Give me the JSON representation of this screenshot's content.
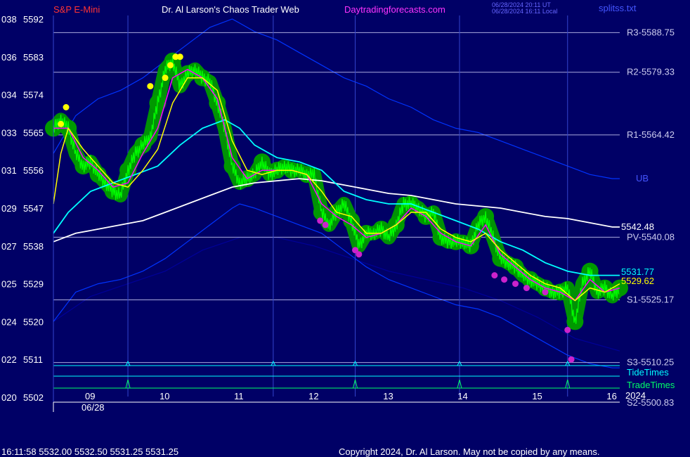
{
  "header": {
    "symbol": "S&P E-Mini",
    "author": "Dr. Al Larson's Chaos Trader Web",
    "site": "Daytradingforecasts.com",
    "stamp_1": "06/28/2024 20:11 UT",
    "stamp_2": "06/28/2024 16:11 Local",
    "file": "splitss.txt"
  },
  "footer": {
    "quote": "16:11:58  5532.00 5532.50 5531.25 5531.25",
    "copyright": "Copyright 2024, Dr. Al Larson. May not be copied by any means."
  },
  "colors": {
    "background": "#000066",
    "price": "#00ff00",
    "ema_fast": "#ff00ff",
    "ema_mid": "#ffff00",
    "ema_cyan": "#00ffff",
    "ema_white": "#ffffff",
    "band": "#0033ff",
    "flux_glow": "#009900",
    "level_line": "#aaaadd",
    "tide": "#00ffff",
    "trade": "#00ff66",
    "symbol_text": "#ff3333",
    "site_text": "#ff33ff"
  },
  "chart_data": {
    "type": "line",
    "title": "S&P E-Mini",
    "xlabel": "",
    "ylabel": "",
    "date_label": "06/28",
    "x_ticks": [
      "09",
      "10",
      "11",
      "12",
      "13",
      "14",
      "15",
      "16"
    ],
    "y_ticks": [
      {
        "left": "020",
        "price": "5502",
        "value": 5502
      },
      {
        "left": "022",
        "price": "5511",
        "value": 5511
      },
      {
        "left": "024",
        "price": "5520",
        "value": 5520
      },
      {
        "left": "025",
        "price": "5529",
        "value": 5529
      },
      {
        "left": "027",
        "price": "5538",
        "value": 5538
      },
      {
        "left": "029",
        "price": "5547",
        "value": 5547
      },
      {
        "left": "031",
        "price": "5556",
        "value": 5556
      },
      {
        "left": "033",
        "price": "5565",
        "value": 5565
      },
      {
        "left": "034",
        "price": "5574",
        "value": 5574
      },
      {
        "left": "036",
        "price": "5583",
        "value": 5583
      },
      {
        "left": "038",
        "price": "5592",
        "value": 5592
      }
    ],
    "ylim": [
      5502,
      5594
    ],
    "xlim": [
      8.5,
      16.1
    ],
    "levels": [
      {
        "label": "R3-5588.75",
        "value": 5588.75
      },
      {
        "label": "R2-5579.33",
        "value": 5579.33
      },
      {
        "label": "R1-5564.42",
        "value": 5564.42
      },
      {
        "label": "PV-5540.08",
        "value": 5540.08
      },
      {
        "label": "S1-5525.17",
        "value": 5525.17
      },
      {
        "label": "S3-5510.25",
        "value": 5510.25
      },
      {
        "label": "S2-5500.83",
        "value": 5500.83
      }
    ],
    "ub_label": "UB",
    "end_labels": [
      {
        "text": "5542.48",
        "value": 5542.48,
        "color": "#ffffff"
      },
      {
        "text": "5531.77",
        "value": 5531.77,
        "color": "#00ffff"
      },
      {
        "text": "5529.62",
        "value": 5529.62,
        "color": "#ffff00"
      }
    ],
    "tide_label": "TideTimes",
    "trade_label": "TradeTimes",
    "trade_year": "2024",
    "vlines": [
      9.5,
      11.45,
      12.55,
      13.95,
      15.4
    ],
    "tide_times": [
      9.5,
      11.45,
      12.55,
      13.95,
      15.4
    ],
    "trade_times": [
      9.5,
      12.55,
      13.95,
      15.4
    ],
    "series": [
      {
        "name": "price",
        "color": "#00ff00",
        "x": [
          8.5,
          8.6,
          8.7,
          8.8,
          8.9,
          9.0,
          9.1,
          9.2,
          9.3,
          9.4,
          9.5,
          9.6,
          9.7,
          9.8,
          9.9,
          10.0,
          10.1,
          10.2,
          10.3,
          10.4,
          10.5,
          10.6,
          10.7,
          10.8,
          10.9,
          11.0,
          11.1,
          11.2,
          11.3,
          11.4,
          11.5,
          11.6,
          11.7,
          11.8,
          11.9,
          12.0,
          12.1,
          12.2,
          12.3,
          12.4,
          12.5,
          12.6,
          12.7,
          12.8,
          12.9,
          13.0,
          13.1,
          13.2,
          13.3,
          13.4,
          13.5,
          13.6,
          13.7,
          13.8,
          13.9,
          14.0,
          14.1,
          14.2,
          14.3,
          14.4,
          14.5,
          14.6,
          14.7,
          14.8,
          14.9,
          15.0,
          15.1,
          15.2,
          15.3,
          15.4,
          15.5,
          15.6,
          15.7,
          15.8,
          15.9,
          16.0,
          16.1
        ],
        "y": [
          5566,
          5568,
          5566,
          5560,
          5557,
          5558,
          5555,
          5553,
          5551,
          5550,
          5556,
          5560,
          5562,
          5564,
          5572,
          5580,
          5582,
          5576,
          5579,
          5580,
          5578,
          5577,
          5572,
          5566,
          5557,
          5553,
          5554,
          5555,
          5558,
          5555,
          5556,
          5557,
          5556,
          5556,
          5555,
          5555,
          5546,
          5543,
          5546,
          5548,
          5544,
          5538,
          5541,
          5541,
          5542,
          5540,
          5543,
          5548,
          5548,
          5547,
          5545,
          5546,
          5540,
          5539,
          5539,
          5539,
          5538,
          5543,
          5545,
          5540,
          5535,
          5534,
          5533,
          5531,
          5530,
          5529,
          5528,
          5527,
          5527,
          5528,
          5520,
          5529,
          5532,
          5527,
          5528,
          5526,
          5528
        ]
      },
      {
        "name": "fast",
        "color": "#ff00ff",
        "x": [
          8.5,
          8.7,
          8.9,
          9.1,
          9.3,
          9.5,
          9.7,
          9.9,
          10.1,
          10.3,
          10.5,
          10.7,
          10.9,
          11.1,
          11.3,
          11.5,
          11.7,
          11.9,
          12.1,
          12.3,
          12.5,
          12.7,
          12.9,
          13.1,
          13.3,
          13.5,
          13.7,
          13.9,
          14.1,
          14.3,
          14.5,
          14.7,
          14.9,
          15.1,
          15.3,
          15.5,
          15.7,
          15.9,
          16.1
        ],
        "y": [
          5566,
          5566,
          5559,
          5556,
          5552,
          5553,
          5560,
          5566,
          5578,
          5580,
          5578,
          5573,
          5559,
          5554,
          5556,
          5556,
          5556,
          5555,
          5548,
          5545,
          5543,
          5540,
          5541,
          5543,
          5547,
          5545,
          5541,
          5539,
          5538,
          5543,
          5536,
          5533,
          5530,
          5528,
          5527,
          5525,
          5530,
          5527,
          5528
        ]
      },
      {
        "name": "mid",
        "color": "#ffff00",
        "x": [
          8.5,
          8.6,
          8.7,
          8.9,
          9.1,
          9.3,
          9.5,
          9.7,
          9.9,
          10.1,
          10.3,
          10.5,
          10.7,
          10.9,
          11.1,
          11.3,
          11.5,
          11.7,
          11.9,
          12.1,
          12.3,
          12.5,
          12.7,
          12.9,
          13.1,
          13.3,
          13.5,
          13.7,
          13.9,
          14.1,
          14.3,
          14.5,
          14.7,
          14.9,
          15.1,
          15.3,
          15.5,
          15.7,
          15.9,
          16.1
        ],
        "y": [
          5548,
          5560,
          5566,
          5561,
          5557,
          5553,
          5552,
          5556,
          5561,
          5572,
          5578,
          5578,
          5575,
          5563,
          5556,
          5555,
          5556,
          5556,
          5555,
          5551,
          5546,
          5545,
          5541,
          5541,
          5543,
          5546,
          5546,
          5542,
          5540,
          5539,
          5541,
          5537,
          5534,
          5531,
          5529,
          5528,
          5525,
          5528,
          5527,
          5529
        ]
      },
      {
        "name": "cyan",
        "color": "#00ffff",
        "x": [
          8.5,
          8.7,
          9.0,
          9.3,
          9.6,
          9.9,
          10.2,
          10.5,
          10.8,
          11.0,
          11.2,
          11.5,
          11.8,
          12.1,
          12.4,
          12.7,
          13.0,
          13.3,
          13.6,
          13.9,
          14.2,
          14.5,
          14.8,
          15.1,
          15.4,
          15.7,
          16.0,
          16.1
        ],
        "y": [
          5541,
          5546,
          5551,
          5553,
          5555,
          5557,
          5562,
          5566,
          5568,
          5566,
          5562,
          5559,
          5558,
          5556,
          5551,
          5549,
          5548,
          5548,
          5546,
          5544,
          5542,
          5539,
          5537,
          5534,
          5532,
          5531,
          5531,
          5531
        ]
      },
      {
        "name": "white",
        "color": "#ffffff",
        "x": [
          8.5,
          8.8,
          9.1,
          9.4,
          9.7,
          10.0,
          10.3,
          10.6,
          10.9,
          11.2,
          11.5,
          11.8,
          12.1,
          12.4,
          12.7,
          13.0,
          13.3,
          13.6,
          13.9,
          14.2,
          14.5,
          14.8,
          15.1,
          15.4,
          15.7,
          16.0,
          16.1
        ],
        "y": [
          5539,
          5541,
          5542,
          5543,
          5544,
          5546,
          5548,
          5550,
          5552,
          5553,
          5553.5,
          5554,
          5553.5,
          5552.5,
          5551.5,
          5550.5,
          5550,
          5549,
          5548,
          5547.5,
          5547,
          5546,
          5545,
          5544.5,
          5543.5,
          5542.5,
          5542.5
        ]
      },
      {
        "name": "upper_band",
        "color": "#0033ff",
        "x": [
          8.5,
          8.8,
          9.1,
          9.4,
          9.7,
          10.0,
          10.3,
          10.6,
          10.9,
          11.0,
          11.2,
          11.5,
          11.8,
          12.1,
          12.4,
          12.7,
          13.0,
          13.3,
          13.6,
          13.9,
          14.2,
          14.5,
          14.8,
          15.1,
          15.4,
          15.7,
          16.0,
          16.1
        ],
        "y": [
          5560,
          5569,
          5573,
          5575,
          5578,
          5582,
          5586,
          5590,
          5592,
          5591,
          5589,
          5587,
          5584,
          5581,
          5578,
          5576,
          5573,
          5571,
          5568,
          5566,
          5565,
          5563,
          5561,
          5559,
          5557,
          5555,
          5554,
          5554
        ]
      },
      {
        "name": "lower_band",
        "color": "#0033ff",
        "x": [
          8.5,
          8.8,
          9.1,
          9.4,
          9.7,
          10.0,
          10.3,
          10.6,
          10.9,
          11.0,
          11.2,
          11.5,
          11.8,
          12.1,
          12.4,
          12.7,
          13.0,
          13.3,
          13.6,
          13.9,
          14.2,
          14.5,
          14.8,
          15.1,
          15.4,
          15.7,
          16.0,
          16.1
        ],
        "y": [
          5520,
          5527,
          5529,
          5530,
          5532,
          5535,
          5539,
          5543,
          5547,
          5548,
          5547,
          5545,
          5543,
          5541,
          5537,
          5533,
          5530,
          5528,
          5526,
          5524,
          5523,
          5521,
          5518,
          5515,
          5512,
          5510,
          5509,
          5509
        ]
      },
      {
        "name": "dark_band",
        "color": "#000099",
        "x": [
          8.5,
          9.0,
          9.5,
          10.0,
          10.5,
          11.0,
          11.5,
          12.0,
          12.5,
          13.0,
          13.5,
          14.0,
          14.5,
          15.0,
          15.5,
          16.1
        ],
        "y": [
          5520,
          5526,
          5529,
          5532,
          5537,
          5540,
          5540,
          5538,
          5535,
          5532,
          5530,
          5528,
          5525,
          5521,
          5516,
          5513
        ]
      }
    ],
    "markers": {
      "yellow": {
        "x": [
          8.6,
          8.67,
          9.8,
          10.0,
          10.07,
          10.14,
          10.2
        ],
        "y": [
          5567,
          5571,
          5576,
          5578,
          5581,
          5583,
          5583
        ]
      },
      "magenta": {
        "x": [
          12.08,
          12.15,
          12.55,
          12.6,
          14.42,
          14.55,
          14.7,
          14.85,
          15.1,
          15.4,
          15.45
        ],
        "y": [
          5544,
          5543,
          5537,
          5536,
          5531,
          5530,
          5529,
          5528,
          5527,
          5518,
          5511
        ]
      }
    }
  }
}
